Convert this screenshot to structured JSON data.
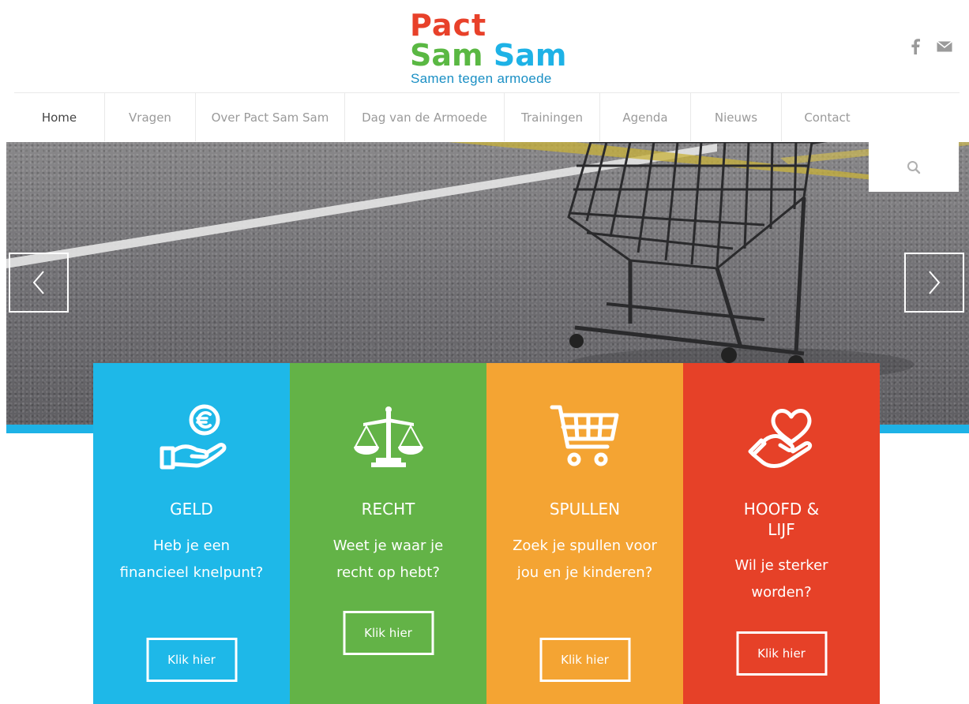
{
  "header": {
    "logo": {
      "line1": "Pact",
      "line2_word1": "Sam",
      "line2_word2": "Sam",
      "tagline": "Samen tegen armoede",
      "colors": {
        "red": "#e8412a",
        "green": "#5ab843",
        "blue": "#1eb2e6"
      }
    },
    "social": [
      {
        "icon": "facebook-icon"
      },
      {
        "icon": "mail-icon"
      }
    ]
  },
  "nav": {
    "items": [
      {
        "label": "Home",
        "active": true
      },
      {
        "label": "Vragen"
      },
      {
        "label": "Over Pact Sam Sam"
      },
      {
        "label": "Dag van de Armoede"
      },
      {
        "label": "Trainingen"
      },
      {
        "label": "Agenda"
      },
      {
        "label": "Nieuws"
      },
      {
        "label": "Contact"
      }
    ],
    "search_icon": "search-icon"
  },
  "slider": {
    "prev_icon": "chevron-left-icon",
    "next_icon": "chevron-right-icon"
  },
  "cards": [
    {
      "title": "GELD",
      "text": "Heb je een financieel knelpunt?",
      "button": "Klik hier",
      "color": "#1eb8e8",
      "icon": "euro-hand-icon"
    },
    {
      "title": "RECHT",
      "text": "Weet je waar je recht op hebt?",
      "button": "Klik hier",
      "color": "#63b347",
      "icon": "scales-icon"
    },
    {
      "title": "SPULLEN",
      "text": "Zoek je spullen voor jou en je kinderen?",
      "button": "Klik hier",
      "color": "#f4a433",
      "icon": "shopping-cart-icon"
    },
    {
      "title": "HOOFD & LIJF",
      "text": "Wil je sterker worden?",
      "button": "Klik hier",
      "color": "#e64128",
      "icon": "heart-hand-icon"
    }
  ]
}
